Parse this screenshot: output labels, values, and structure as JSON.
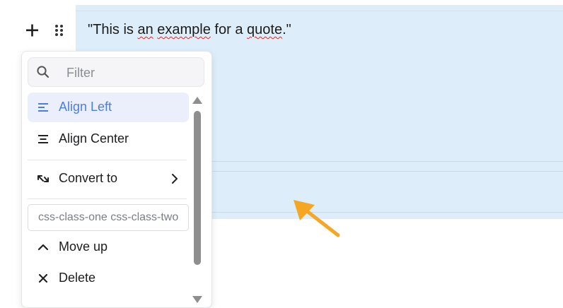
{
  "editor": {
    "quote_text_parts": [
      "\"This is ",
      "an",
      " ",
      "example",
      " for a ",
      "quote",
      ".\""
    ],
    "highlight_color": "#ddeefa"
  },
  "toolbar": {
    "add_icon": "plus-icon",
    "drag_icon": "drag-handle-icon"
  },
  "menu": {
    "filter": {
      "placeholder": "Filter",
      "value": "",
      "icon": "search-icon"
    },
    "items": [
      {
        "label": "Align Left",
        "icon": "align-left-icon",
        "active": true
      },
      {
        "label": "Align Center",
        "icon": "align-center-icon",
        "active": false
      },
      {
        "label": "Convert to",
        "icon": "convert-icon",
        "submenu": true
      },
      {
        "label": "Move up",
        "icon": "chevron-up-icon"
      },
      {
        "label": "Delete",
        "icon": "close-icon"
      }
    ],
    "css_class_value": "css-class-one css-class-two",
    "accent_color": "#4e7de0"
  },
  "annotation": {
    "arrow_color": "#f5a623"
  }
}
